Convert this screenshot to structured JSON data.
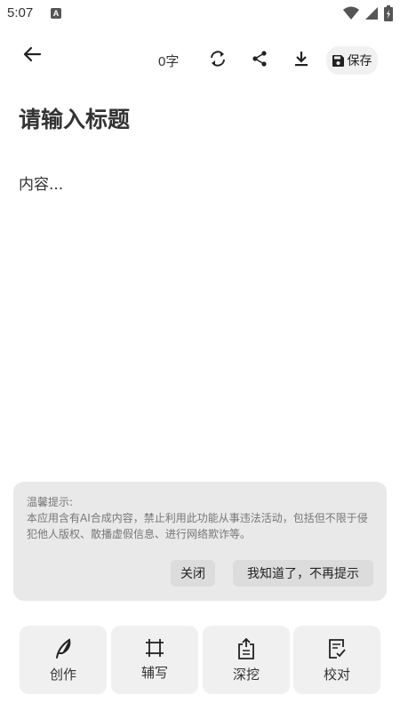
{
  "status_bar": {
    "time": "5:07",
    "notification_badge": "A"
  },
  "toolbar": {
    "word_count": "0字",
    "save_label": "保存"
  },
  "editor": {
    "title_placeholder": "请输入标题",
    "content_placeholder": "内容..."
  },
  "tip": {
    "title": "温馨提示:",
    "body": "本应用含有AI合成内容，禁止利用此功能从事违法活动，包括但不限于侵犯他人版权、散播虚假信息、进行网络欺诈等。",
    "close_label": "关闭",
    "dismiss_label": "我知道了，不再提示"
  },
  "bottom_tabs": [
    {
      "label": "创作",
      "icon": "feather-icon"
    },
    {
      "label": "辅写",
      "icon": "crop-icon"
    },
    {
      "label": "深挖",
      "icon": "clipboard-upload-icon"
    },
    {
      "label": "校对",
      "icon": "document-check-icon"
    }
  ],
  "colors": {
    "card_bg": "#e9e9e9",
    "tab_bg": "#f0f0f0",
    "button_bg": "#dcdcdc"
  }
}
